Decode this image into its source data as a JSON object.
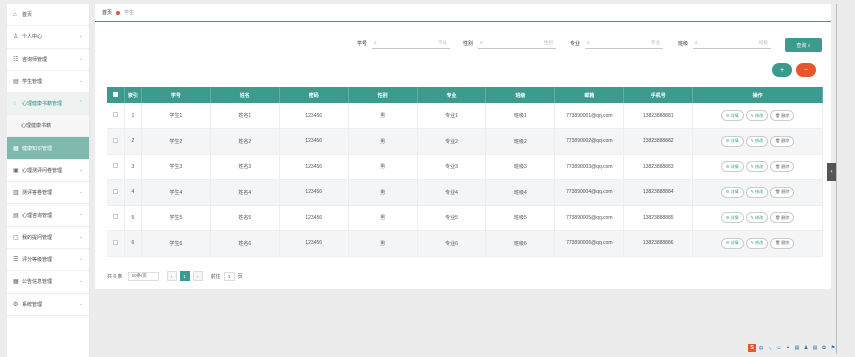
{
  "sidebar": {
    "items": [
      {
        "label": "首页",
        "icon": "home-icon",
        "glyph": "⌂"
      },
      {
        "label": "个人中心",
        "icon": "user-icon",
        "glyph": "♙",
        "chev": "⌄"
      },
      {
        "label": "咨询师管理",
        "icon": "list-icon",
        "glyph": "☷",
        "chev": "⌄"
      },
      {
        "label": "学生管理",
        "icon": "chart-icon",
        "glyph": "▤",
        "chev": "⌄"
      },
      {
        "label": "心理健康书籍管理",
        "icon": "chat-icon",
        "glyph": "◌",
        "chev": "⌃"
      },
      {
        "label": "心理健康书籍",
        "sub": true
      },
      {
        "label": "健康知识管理",
        "icon": "grid-icon",
        "glyph": "▦",
        "chev": "⌄",
        "active": true
      },
      {
        "label": "心理测评问卷管理",
        "icon": "doc-icon",
        "glyph": "▣",
        "chev": "⌄"
      },
      {
        "label": "测评答卷管理",
        "icon": "form-icon",
        "glyph": "▥",
        "chev": "⌄"
      },
      {
        "label": "心理咨询管理",
        "icon": "message-icon",
        "glyph": "▤",
        "chev": "⌄"
      },
      {
        "label": "我的提问管理",
        "icon": "question-icon",
        "glyph": "▢",
        "chev": "⌄"
      },
      {
        "label": "评分等级管理",
        "icon": "rating-icon",
        "glyph": "☰",
        "chev": "⌄"
      },
      {
        "label": "公告信息管理",
        "icon": "notice-icon",
        "glyph": "▦",
        "chev": "⌄"
      },
      {
        "label": "系统管理",
        "icon": "settings-icon",
        "glyph": "⚙",
        "chev": "⌄"
      }
    ]
  },
  "breadcrumb": {
    "home": "首页",
    "current": "学生"
  },
  "filter": {
    "fields": [
      {
        "label": "学号",
        "placeholder": "学号"
      },
      {
        "label": "性别",
        "placeholder": "性别"
      },
      {
        "label": "专业",
        "placeholder": "专业"
      },
      {
        "label": "班级",
        "placeholder": "班级"
      }
    ],
    "search_label": "查询 ⌕"
  },
  "actions": {
    "add": "+",
    "delete": "−"
  },
  "table": {
    "headers": [
      "",
      "索引",
      "学号",
      "姓名",
      "密码",
      "性别",
      "专业",
      "班级",
      "邮箱",
      "手机号",
      "操作"
    ],
    "rows": [
      [
        "1",
        "学生1",
        "姓名1",
        "123456",
        "男",
        "专业1",
        "班级1",
        "773890001@qq.com",
        "13823888881"
      ],
      [
        "2",
        "学生2",
        "姓名2",
        "123456",
        "男",
        "专业2",
        "班级2",
        "773890002@qq.com",
        "13823888882"
      ],
      [
        "3",
        "学生3",
        "姓名3",
        "123456",
        "男",
        "专业3",
        "班级3",
        "773890003@qq.com",
        "13823888883"
      ],
      [
        "4",
        "学生4",
        "姓名4",
        "123456",
        "男",
        "专业4",
        "班级4",
        "773890004@qq.com",
        "13823888884"
      ],
      [
        "5",
        "学生5",
        "姓名5",
        "123456",
        "男",
        "专业5",
        "班级5",
        "773890005@qq.com",
        "13823888885"
      ],
      [
        "6",
        "学生6",
        "姓名6",
        "123456",
        "男",
        "专业6",
        "班级6",
        "773890006@qq.com",
        "13823888886"
      ]
    ],
    "ops": {
      "detail": "☰ 详情",
      "edit": "✎ 修改",
      "remove": "🗑 删除"
    }
  },
  "pager": {
    "total": "共 6 条",
    "page_size": "10条/页",
    "prev": "‹",
    "page": "1",
    "next": "›",
    "goto": "前往",
    "goto_value": "1",
    "page_unit": "页"
  },
  "ime": [
    "S",
    "中",
    "·,",
    "☺",
    "⌖",
    "▤",
    "♟",
    "▤",
    "✿",
    "⚑"
  ],
  "colors": {
    "accent": "#3a9b8e",
    "danger": "#e8562c"
  }
}
